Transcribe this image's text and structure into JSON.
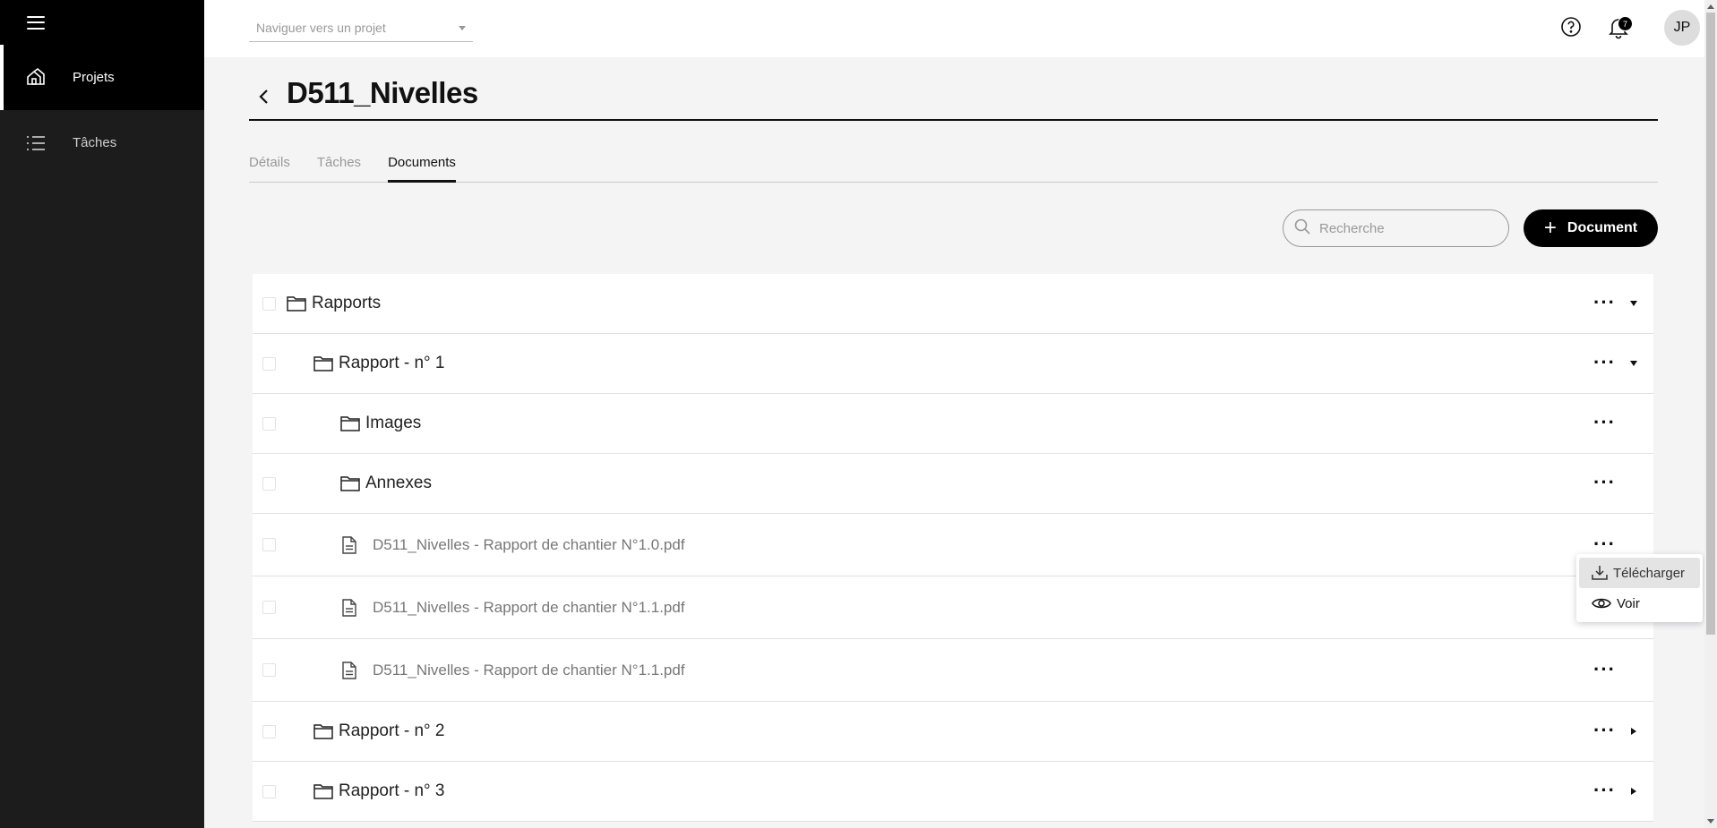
{
  "sidebar": {
    "items": [
      {
        "label": "Projets",
        "icon": "home-icon",
        "active": true
      },
      {
        "label": "Tâches",
        "icon": "list-icon",
        "active": false
      }
    ]
  },
  "topbar": {
    "project_select_placeholder": "Naviguer vers un projet",
    "notification_count": "7",
    "avatar_initials": "JP"
  },
  "page": {
    "title": "D511_Nivelles",
    "tabs": [
      "Détails",
      "Tâches",
      "Documents"
    ],
    "active_tab": "Documents"
  },
  "toolbar": {
    "search_placeholder": "Recherche",
    "add_document_label": "Document"
  },
  "tree": {
    "rows": [
      {
        "type": "folder",
        "name": "Rapports",
        "level": 0,
        "expander": "expanded"
      },
      {
        "type": "folder",
        "name": "Rapport - n° 1",
        "level": 1,
        "expander": "expanded"
      },
      {
        "type": "folder",
        "name": "Images",
        "level": 2,
        "expander": "none"
      },
      {
        "type": "folder",
        "name": "Annexes",
        "level": 2,
        "expander": "none"
      },
      {
        "type": "file",
        "name": "D511_Nivelles - Rapport de chantier N°1.0.pdf",
        "level": 2
      },
      {
        "type": "file",
        "name": "D511_Nivelles - Rapport de chantier N°1.1.pdf",
        "level": 2
      },
      {
        "type": "file",
        "name": "D511_Nivelles - Rapport de chantier N°1.1.pdf",
        "level": 2
      },
      {
        "type": "folder",
        "name": "Rapport - n° 2",
        "level": 1,
        "expander": "collapsed"
      },
      {
        "type": "folder",
        "name": "Rapport - n° 3",
        "level": 1,
        "expander": "collapsed"
      }
    ],
    "more_label": "···"
  },
  "context_menu": {
    "items": [
      {
        "label": "Télécharger",
        "icon": "download-icon"
      },
      {
        "label": "Voir",
        "icon": "eye-icon"
      }
    ]
  }
}
